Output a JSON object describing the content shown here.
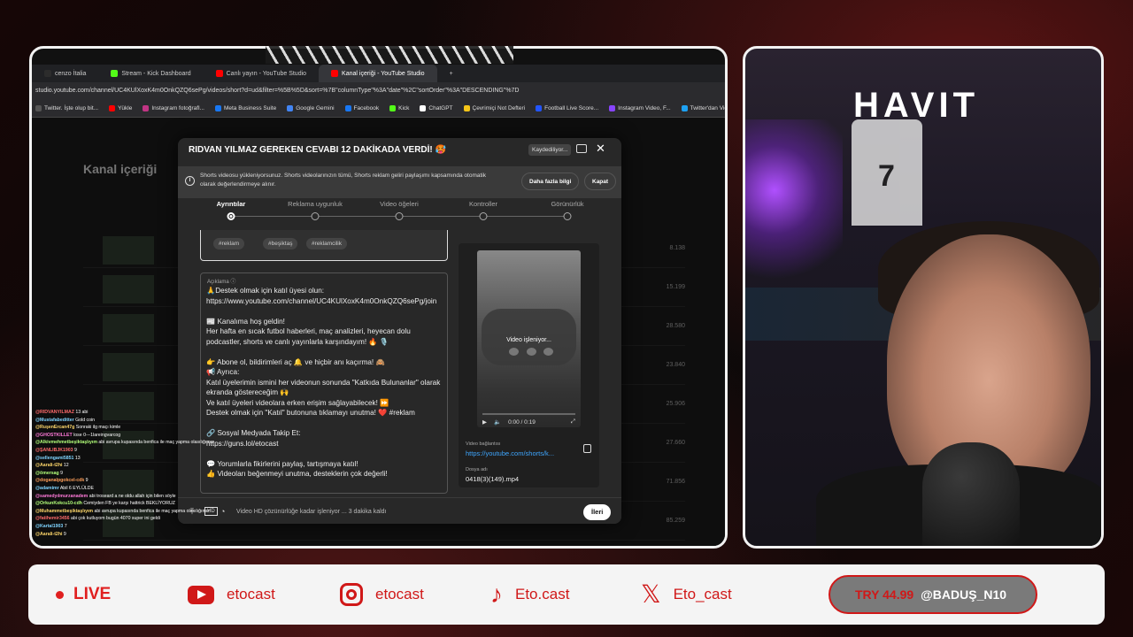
{
  "browser": {
    "tabs": [
      {
        "label": "cenzo İtalia",
        "color": "#2c2c2c"
      },
      {
        "label": "Stream - Kick Dashboard",
        "color": "#53fc18"
      },
      {
        "label": "Canlı yayın - YouTube Studio",
        "color": "#ff0000"
      },
      {
        "label": "Kanal içeriği - YouTube Studio",
        "color": "#ff0000"
      }
    ],
    "new_tab": "+",
    "url": "studio.youtube.com/channel/UC4KUlXoxK4m0OnkQZQ6sePg/videos/short?d=ud&filter=%5B%5D&sort=%7B\"columnType\"%3A\"date\"%2C\"sortOrder\"%3A\"DESCENDING\"%7D",
    "bookmarks": [
      {
        "label": "Twitter. İşte olup bit...",
        "color": "#555"
      },
      {
        "label": "Yükle",
        "color": "#ff0000"
      },
      {
        "label": "Instagram fotoğrafl...",
        "color": "#c13584"
      },
      {
        "label": "Meta Business Suite",
        "color": "#1877f2"
      },
      {
        "label": "Google Gemini",
        "color": "#4285f4"
      },
      {
        "label": "Facebook",
        "color": "#1877f2"
      },
      {
        "label": "Kick",
        "color": "#53fc18"
      },
      {
        "label": "ChatGPT",
        "color": "#ffffff"
      },
      {
        "label": "Çevrimiçi Not Defteri",
        "color": "#f5c518"
      },
      {
        "label": "Football Live Score...",
        "color": "#2255ff"
      },
      {
        "label": "Instagram Video, F...",
        "color": "#8844ff"
      },
      {
        "label": "Twitter'dan Video İ...",
        "color": "#1da1f2"
      }
    ]
  },
  "studio": {
    "title": "Kanal içeriği",
    "row_numbers": [
      "8.138",
      "15.199",
      "28.580",
      "23.840",
      "25.906",
      "27.660",
      "71.856",
      "85.259"
    ]
  },
  "modal": {
    "title": "RIDVAN YILMAZ GEREKEN CEVABI 12 DAKİKADA VERDİ! 🥵",
    "saving": "Kaydediliyor...",
    "close": "✕",
    "notice": "Shorts videosu yükleniyorsunuz. Shorts videolarınızın tümü, Shorts reklam geliri paylaşımı kapsamında otomatik olarak değerlendirmeye alınır.",
    "learn_more": "Daha fazla bilgi",
    "dismiss": "Kapat",
    "steps": [
      "Ayrıntılar",
      "Reklama uygunluk",
      "Video öğeleri",
      "Kontroller",
      "Görünürlük"
    ],
    "tags": [
      "#reklam",
      "#beşiktaş",
      "#reklamcilik"
    ],
    "desc_label": "Açıklama ⓘ",
    "description": "🙏Destek olmak için katıl üyesi olun:\nhttps://www.youtube.com/channel/UC4KUlXoxK4m0OnkQZQ6sePg/join\n\n📰 Kanalıma hoş geldin!\nHer hafta en sıcak futbol haberleri, maç analizleri, heyecan dolu podcastler, shorts ve canlı yayınlarla karşındayım! 🔥 🎙️\n\n👉 Abone ol, bildirimleri aç 🔔 ve hiçbir anı kaçırma! 🙈\n📢 Ayrıca:\nKatıl üyelerimin ismini her videonun sonunda \"Katkıda Bulunanlar\" olarak ekranda göstereceğim 🙌\nVe katıl üyeleri videolara erken erişim sağlayabilecek! ⏩\nDestek olmak için \"Katıl\" butonuna tıklamayı unutma! ❤️ #reklam\n\n🔗 Sosyal Medyada Takip Et:\nhttps://guns.lol/etocast\n\n💬 Yorumlarla fikirlerini paylaş, tartışmaya katıl!\n👍 Videoları beğenmeyi unutma, desteklerin çok değerli!",
    "processing": "Video işleniyor...",
    "time": "0:00 / 0:19",
    "link_label": "Video bağlantısı",
    "link": "https://youtube.com/shorts/k...",
    "file_label": "Dosya adı",
    "file": "0418(3)(149).mp4",
    "status": "Video HD çözünürlüğe kadar işleniyor ... 3 dakika kaldı",
    "hd": "HD",
    "next": "İleri"
  },
  "chat": [
    {
      "user": "@RIDVANYILMAZ",
      "color": "#ff6b6b",
      "msg": "13 abi"
    },
    {
      "user": "@Mustafabeditter",
      "color": "#7fd4ff",
      "msg": "Gold coin"
    },
    {
      "user": "@RuşenErcan47g",
      "color": "#ffd86b",
      "msg": "Sonraki ilg maçı kimle"
    },
    {
      "user": "@GHOSTKILLET",
      "color": "#ff7ad9",
      "msg": "lose 0---1lareingvarcog"
    },
    {
      "user": "@Alkivmehmetbeşiktaşlıyım",
      "color": "#b3ff7a",
      "msg": "abi avrupa kupasında benfica ile maç yapma olasılığımız"
    },
    {
      "user": "@ŞANLIBJK1903",
      "color": "#ff6b6b",
      "msg": "9"
    },
    {
      "user": "@sellengami5851",
      "color": "#7fd4ff",
      "msg": "13"
    },
    {
      "user": "@Aarali-t2hi",
      "color": "#ffd86b",
      "msg": "12"
    },
    {
      "user": "@ömersag",
      "color": "#b3ff7a",
      "msg": "9"
    },
    {
      "user": "@doganalpgokcel-cdk",
      "color": "#ff9f5a",
      "msg": "9"
    },
    {
      "user": "@adamimr",
      "color": "#7fd4ff",
      "msg": "Abil 6 EYLÜLDE"
    },
    {
      "user": "@samedyılmurzanadem",
      "color": "#ff7ad9",
      "msg": "abi troseard a ne oldu allah için bilen söyle"
    },
    {
      "user": "@OrkunKokcu10-cdh",
      "color": "#b3ff7a",
      "msg": "Cemiyden FB ye karşı hattrick BEKLİYORUZ"
    },
    {
      "user": "@Muhammetbeşiktaşlıyım",
      "color": "#ffd86b",
      "msg": "abi avrupa kupasında benfica ile maç yapma olasılığımız"
    },
    {
      "user": "@fatihemir3456",
      "color": "#ff6b6b",
      "msg": "abi çok kutluyom bugün 4070 super ini geldi"
    },
    {
      "user": "@Kartal1903",
      "color": "#7fd4ff",
      "msg": "7"
    },
    {
      "user": "@Aarali-t2hi",
      "color": "#ffd86b",
      "msg": "9"
    }
  ],
  "brand": "HAVIT",
  "bottom": {
    "live": "LIVE",
    "youtube": "etocast",
    "instagram": "etocast",
    "tiktok": "Eto.cast",
    "x": "Eto_cast",
    "donation_amount": "TRY 44.99",
    "donation_user": "@BADUŞ_N10"
  }
}
